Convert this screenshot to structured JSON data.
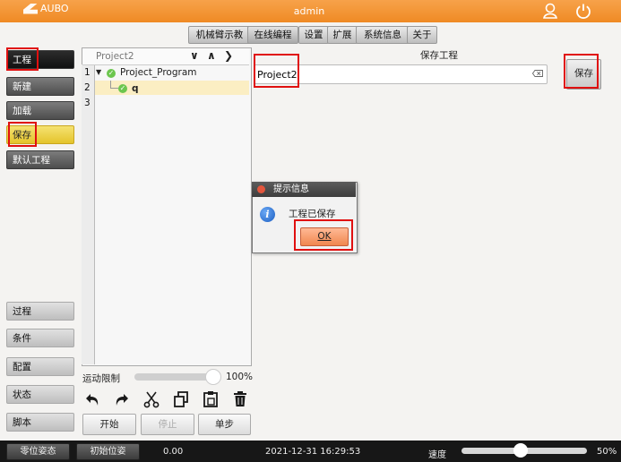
{
  "app": {
    "logo_text": "AUBO",
    "user": "admin",
    "accent": "#ef8a24"
  },
  "tabs": [
    {
      "label": "机械臂示教"
    },
    {
      "label": "在线编程"
    },
    {
      "label": "设置"
    },
    {
      "label": "扩展"
    },
    {
      "label": "系统信息"
    },
    {
      "label": "关于"
    }
  ],
  "sidebar": {
    "header": "工程",
    "items": [
      {
        "label": "新建"
      },
      {
        "label": "加载"
      },
      {
        "label": "保存"
      },
      {
        "label": "默认工程"
      }
    ],
    "bottom": [
      {
        "label": "过程"
      },
      {
        "label": "条件"
      },
      {
        "label": "配置"
      },
      {
        "label": "状态"
      },
      {
        "label": "脚本"
      }
    ]
  },
  "tree": {
    "project_name": "Project2",
    "line_numbers": [
      "1",
      "2",
      "3"
    ],
    "nodes": [
      {
        "label": "Project_Program"
      },
      {
        "label": "q"
      }
    ]
  },
  "save_panel": {
    "title": "保存工程",
    "input_value": "Project2",
    "save_label": "保存"
  },
  "dialog": {
    "title": "提示信息",
    "message": "工程已保存",
    "ok_label": "OK"
  },
  "motion": {
    "label": "运动限制",
    "value": "100%",
    "fraction": 1.0
  },
  "controls": {
    "start": "开始",
    "stop": "停止",
    "step": "单步"
  },
  "statusbar": {
    "zero_pose": "零位姿态",
    "init_pose": "初始位姿",
    "value": "0.00",
    "datetime": "2021-12-31 16:29:53",
    "speed_label": "速度",
    "speed_value": "50%",
    "speed_fraction": 0.5
  }
}
